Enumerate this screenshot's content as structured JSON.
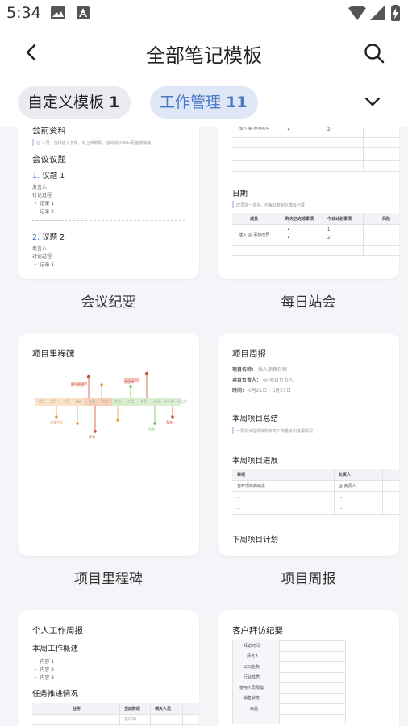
{
  "status": {
    "time": "5:34"
  },
  "header": {
    "title": "全部笔记模板"
  },
  "tabs": [
    {
      "label": "自定义模板",
      "count": "1"
    },
    {
      "label": "工作管理",
      "count": "11"
    }
  ],
  "colors": {
    "accent": "#4a78c8",
    "chip_active_bg": "#dfe6f6",
    "chip_bg": "#e9ebf1",
    "background": "#f4f5f9"
  },
  "templates": [
    {
      "name": "会议纪要",
      "preview": {
        "pre_title": "会前资料",
        "pre_hint": "@ 人员，选择插入文件，可上传附件，也可添加Wiki页面或链接",
        "section": "会议议题",
        "topic1": "议题 1",
        "topic1_num": "1.",
        "topic2": "议题 2",
        "topic2_num": "2.",
        "speaker": "发言人：",
        "discussion": "讨论过程",
        "records": [
          "记录 1",
          "记录 2"
        ],
        "record1": "记录 1"
      }
    },
    {
      "name": "每日站会",
      "preview": {
        "at_hint": "插入 @ 添加成员",
        "date_title": "日期",
        "date_hint": "成员逐一发言，可每日复制此模板记录",
        "cols": [
          "成员",
          "昨天已完成事项",
          "今日计划事项",
          "风险"
        ],
        "nums": [
          "1.",
          "2."
        ]
      }
    },
    {
      "name": "项目里程碑",
      "preview": {
        "title": "项目里程碑",
        "months": [
          "一月",
          "二月",
          "三月",
          "四月",
          "五月",
          "六月",
          "七月",
          "八月",
          "九月",
          "十月",
          "十一月",
          "十二月"
        ],
        "markers": [
          "第一阶段",
          "里程碑",
          "关键节点",
          "评审",
          "验收",
          "发布"
        ]
      }
    },
    {
      "name": "项目周报",
      "preview": {
        "title": "项目周报",
        "meta_name": "项目名称：",
        "meta_name_val": "插入项目名称",
        "meta_owner": "项目负责人：",
        "meta_owner_val": "@ 项目负责人",
        "meta_time": "时间：",
        "meta_time_val": "6月21日 - 6月25日",
        "summary_title": "本周项目总结",
        "summary_hint": "一周内该在项目所有的工作重点和进展情况",
        "progress_title": "本周项目进展",
        "col_item": "事项",
        "col_owner": "负责人",
        "row1_item": "召开项目启动会",
        "row1_owner": "@ 负责人",
        "dots": "...",
        "plan_title": "下周项目计划"
      }
    },
    {
      "name": "个人工作周报",
      "preview": {
        "title": "个人工作周报",
        "overview": "本周工作概述",
        "items": [
          "内容 1",
          "内容 2",
          "内容 3"
        ],
        "progress": "任务推进情况",
        "cols": [
          "任务",
          "当前阶段",
          "相关人员"
        ],
        "stage_val": "进行中"
      }
    },
    {
      "name": "客户拜访纪要",
      "preview": {
        "title": "客户拜访纪要",
        "rows": [
          "拜访时间",
          "拜访人",
          "公司名称",
          "行业性质",
          "使用人员规模",
          "销售状态",
          "商品"
        ]
      }
    }
  ]
}
